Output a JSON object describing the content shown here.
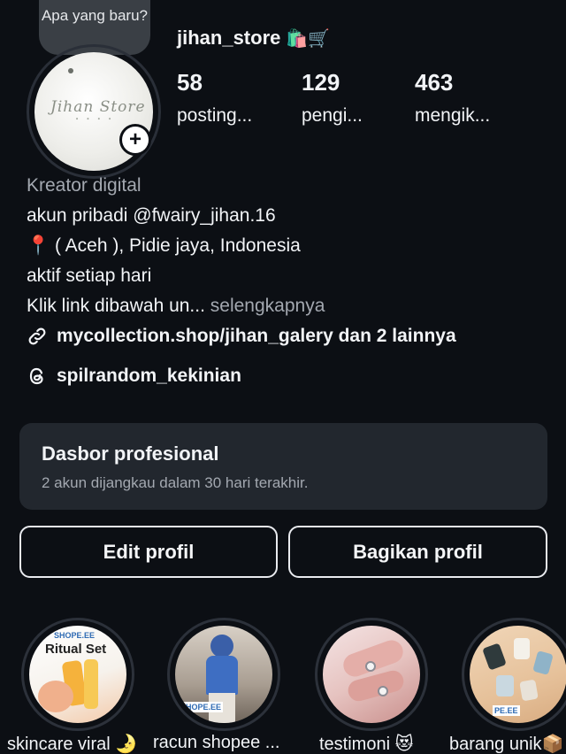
{
  "story_bubble": {
    "text": "Apa yang baru?"
  },
  "profile": {
    "username": "jihan_store",
    "username_emoji": "🛍️🛒",
    "avatar_logo": "Jihan Store",
    "add_story_symbol": "+"
  },
  "stats": [
    {
      "value": "58",
      "label": "posting..."
    },
    {
      "value": "129",
      "label": "pengi..."
    },
    {
      "value": "463",
      "label": "mengik..."
    }
  ],
  "bio": {
    "category": "Kreator digital",
    "line1": "akun pribadi @fwairy_jihan.16",
    "line2": "📍 ( Aceh ), Pidie jaya, Indonesia",
    "line3": "aktif setiap hari",
    "line4": "Klik link dibawah un...",
    "more": " selengkapnya",
    "link": "mycollection.shop/jihan_galery dan 2 lainnya",
    "threads": "spilrandom_kekinian"
  },
  "dashboard": {
    "title": "Dasbor profesional",
    "subtitle": "2 akun dijangkau dalam 30 hari terakhir."
  },
  "buttons": {
    "edit": "Edit profil",
    "share": "Bagikan profil"
  },
  "highlights": [
    {
      "label": "skincare viral 🌛",
      "badge": "SHOPE.EE",
      "title": "Ritual Set"
    },
    {
      "label": "racun shopee ...",
      "badge": "SHOPE.EE"
    },
    {
      "label": "testimoni 😻"
    },
    {
      "label": "barang unik📦",
      "badge": "PE.EE"
    }
  ],
  "colors": {
    "background": "#0c0f14",
    "card": "#22272e",
    "muted_text": "#a3a8b0"
  }
}
